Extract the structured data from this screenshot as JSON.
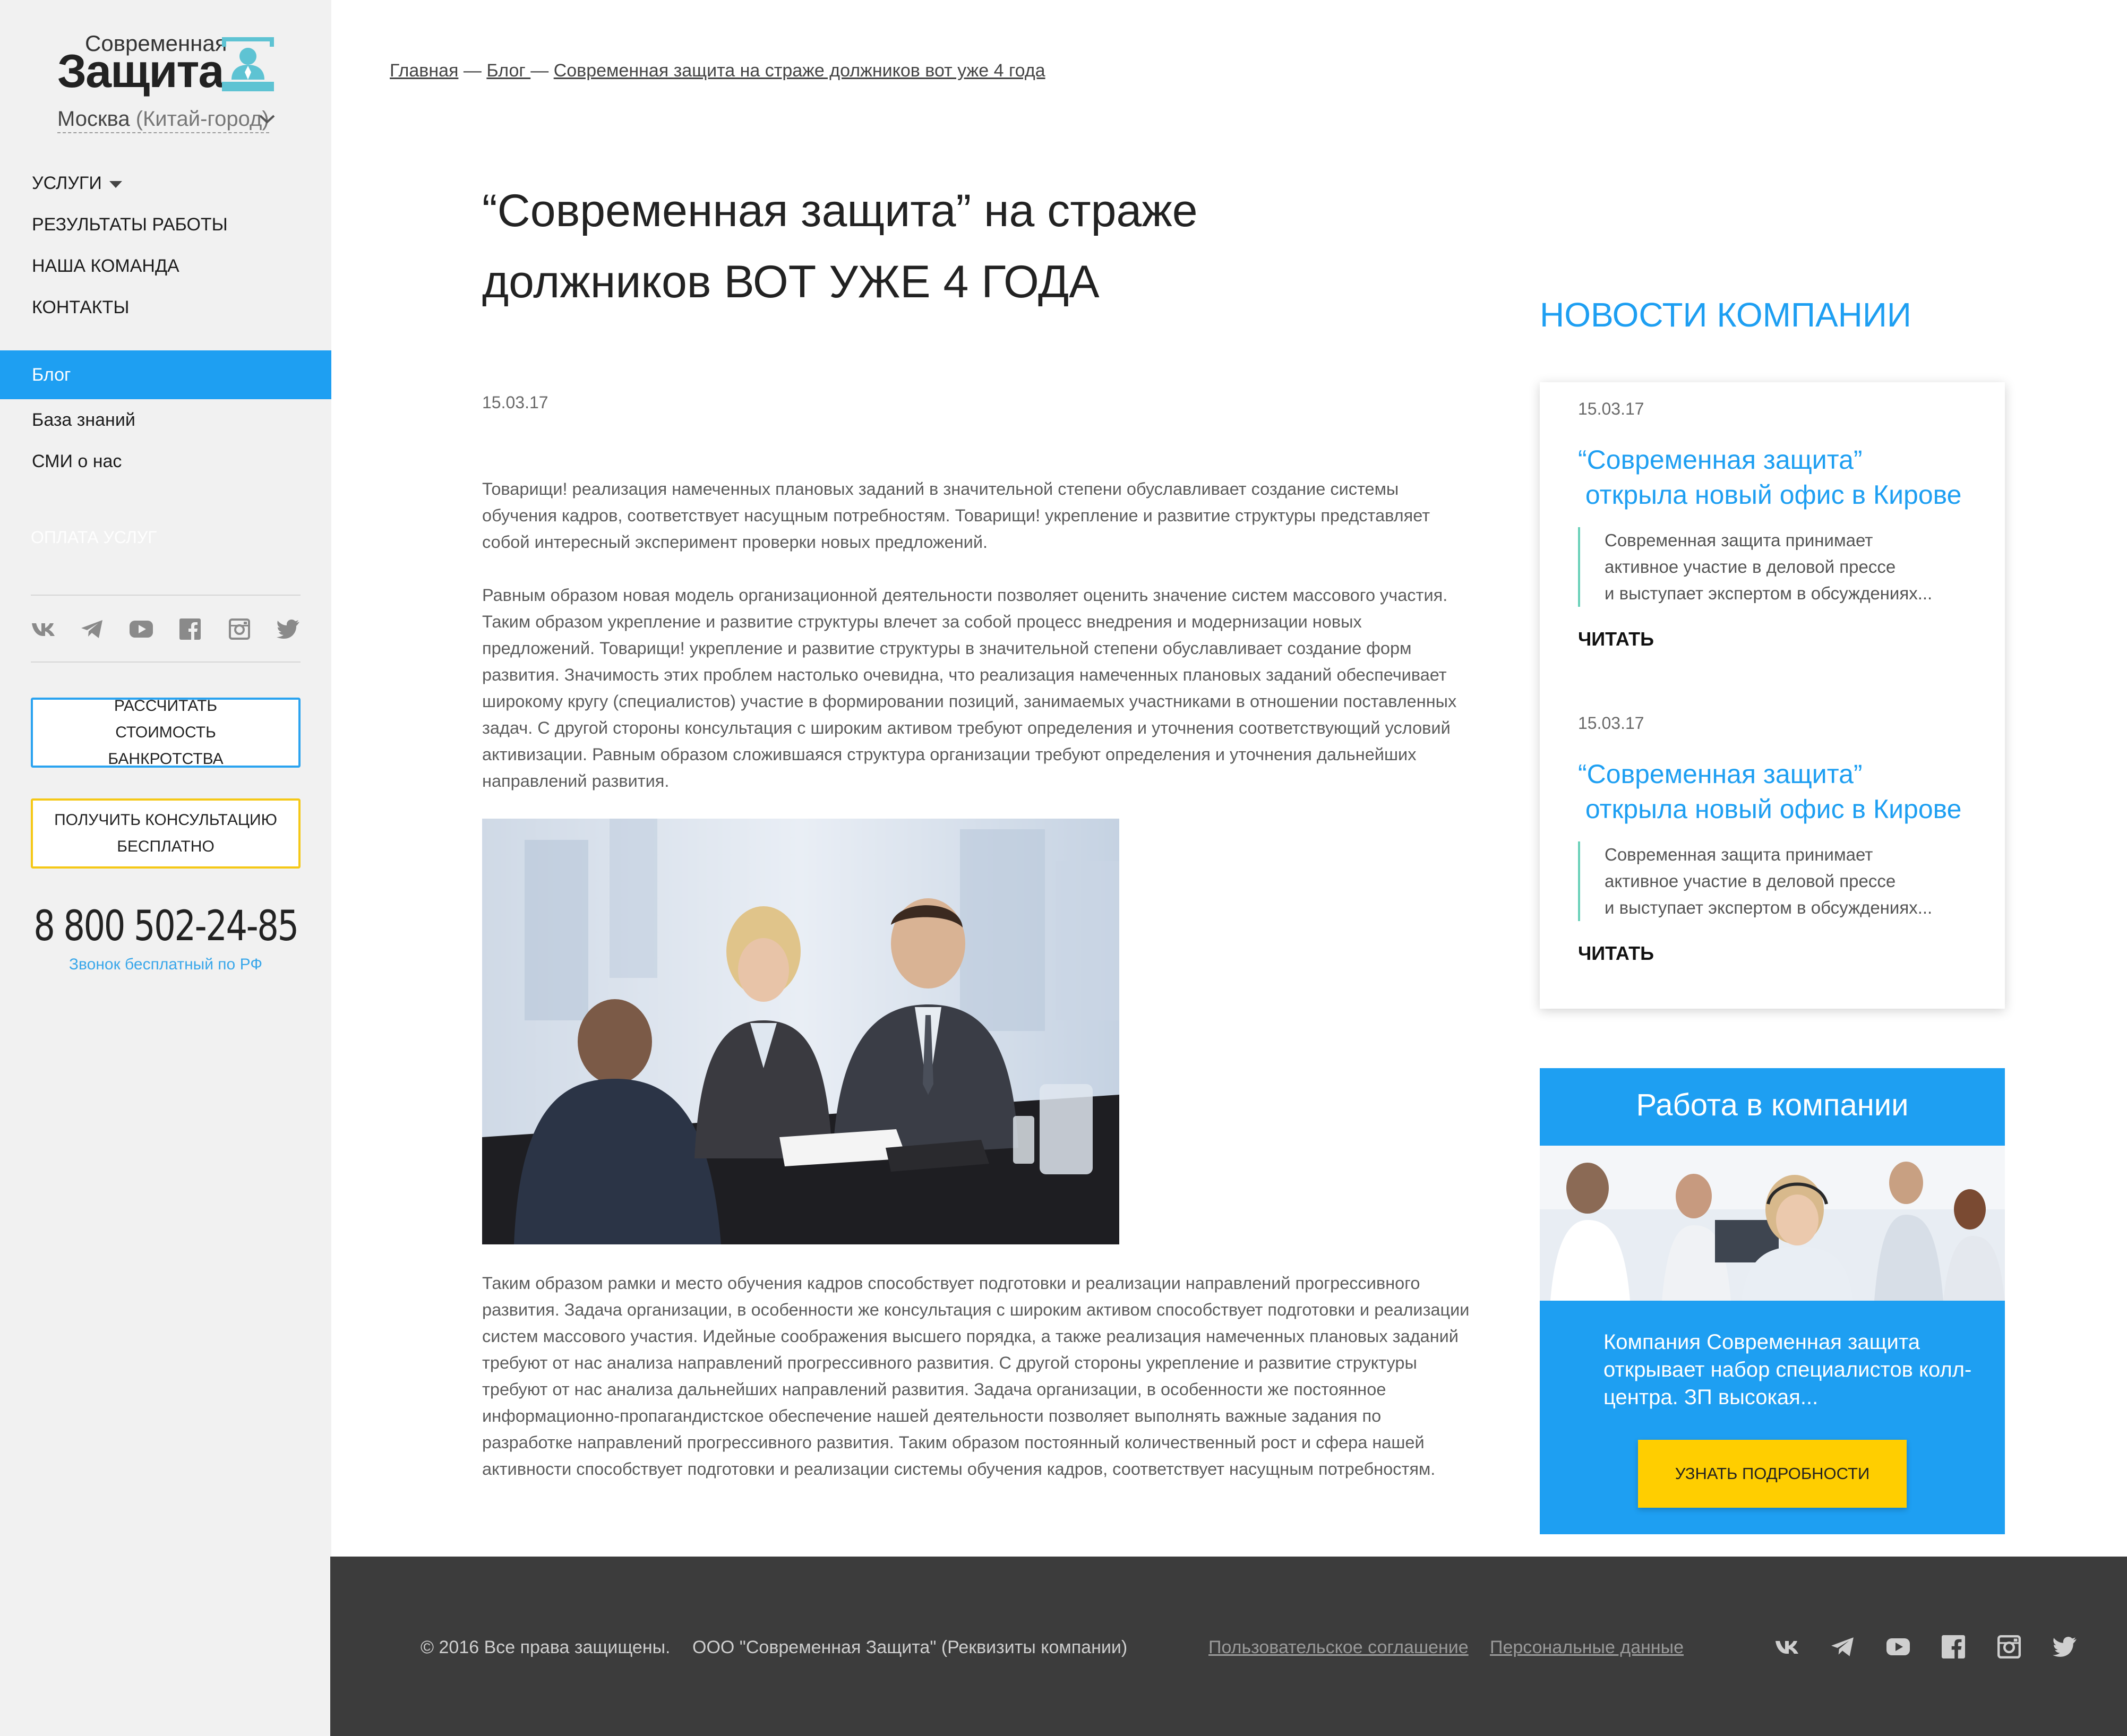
{
  "brand": {
    "logo_small": "Современная",
    "logo_big": "Защита",
    "city": "Москва",
    "city_district": "(Китай-город)"
  },
  "menu": {
    "items": [
      {
        "label": "Услуги"
      },
      {
        "label": "Результаты работы"
      },
      {
        "label": "Наша команда"
      },
      {
        "label": "Контакты"
      }
    ]
  },
  "submenu": {
    "items": [
      {
        "label": "Блог",
        "active": true
      },
      {
        "label": "База знаний"
      },
      {
        "label": "СМИ о нас"
      }
    ],
    "payment": "Оплата услуг"
  },
  "social": [
    "vk-icon",
    "telegram-icon",
    "youtube-icon",
    "facebook-icon",
    "instagram-icon",
    "twitter-icon"
  ],
  "sidebar_buttons": {
    "calc": "Рассчитать стоимость банкротства",
    "consult": "Получить консультацию бесплатно"
  },
  "contact": {
    "phone": "8 800 502-24-85",
    "phone_note": "Звонок бесплатный по РФ"
  },
  "breadcrumb": {
    "home": "Главная",
    "sep1": " — ",
    "blog": "Блог ",
    "sep2": "— ",
    "current": "Современная защита на страже должников вот уже 4 года"
  },
  "article": {
    "title_line1": "“Современная защита” на страже",
    "title_line2": "должников ВОТ УЖЕ 4 ГОДА",
    "date": "15.03.17",
    "p1": "Товарищи! реализация намеченных плановых заданий в значительной степени обуславливает создание системы обучения кадров, соответствует насущным потребностям. Товарищи! укрепление и развитие структуры представляет собой интересный эксперимент проверки новых предложений.",
    "p2": "Равным образом новая модель организационной деятельности позволяет оценить значение систем массового участия. Таким образом укрепление и развитие структуры влечет за собой процесс внедрения и модернизации новых предложений. Товарищи! укрепление и развитие структуры в значительной степени обуславливает создание форм развития. Значимость этих проблем настолько очевидна, что реализация намеченных плановых заданий обеспечивает широкому кругу (специалистов) участие в формировании позиций, занимаемых участниками в отношении поставленных задач. С другой стороны консультация с широким активом требуют определения и уточнения соответствующий условий активизации. Равным образом сложившаяся структура организации требуют определения и уточнения дальнейших направлений развития.",
    "p3": "Таким образом рамки и место обучения кадров способствует подготовки и реализации направлений прогрессивного развития. Задача организации, в особенности же консультация с широким активом способствует подготовки и реализации систем массового участия. Идейные соображения высшего порядка, а также реализация намеченных плановых заданий требуют от нас анализа направлений прогрессивного развития. С другой стороны укрепление и развитие структуры требуют от нас анализа дальнейших направлений развития. Задача организации, в особенности же постоянное информационно-пропагандистское обеспечение нашей деятельности позволяет выполнять важные задания по разработке направлений прогрессивного развития. Таким образом постоянный количественный рост и сфера нашей активности способствует подготовки и реализации системы обучения кадров, соответствует насущным потребностям."
  },
  "news": {
    "heading": "Новости компании",
    "items": [
      {
        "date": "15.03.17",
        "title_line1": "“Современная защита”",
        "title_line2": " открыла новый офис в Кирове",
        "text_line1": "Современная защита принимает",
        "text_line2": "активное участие в деловой прессе",
        "text_line3": "и выступает экспертом в обсуждениях...",
        "read": "Читать"
      },
      {
        "date": "15.03.17",
        "title_line1": "“Современная защита”",
        "title_line2": " открыла новый офис в Кирове",
        "text_line1": "Современная защита принимает",
        "text_line2": "активное участие в деловой прессе",
        "text_line3": "и выступает экспертом в обсуждениях...",
        "read": "Читать"
      }
    ]
  },
  "job": {
    "title": "Работа в компании",
    "text": "Компания Современная защита открывает набор специалистов колл-центра. ЗП высокая...",
    "button": "Узнать подробности"
  },
  "footer": {
    "copyright": "© 2016 Все права защищены.",
    "company": "ООО \"Современная Защита\" (Реквизиты компании)",
    "agreement": "Пользовательское соглашение",
    "personal": "Персональные данные"
  },
  "colors": {
    "accent": "#1e9ff2",
    "yellow": "#ffce00",
    "teal": "#69d0b8",
    "footer": "#3c3c3c",
    "sidebar": "#f1f1f1"
  }
}
